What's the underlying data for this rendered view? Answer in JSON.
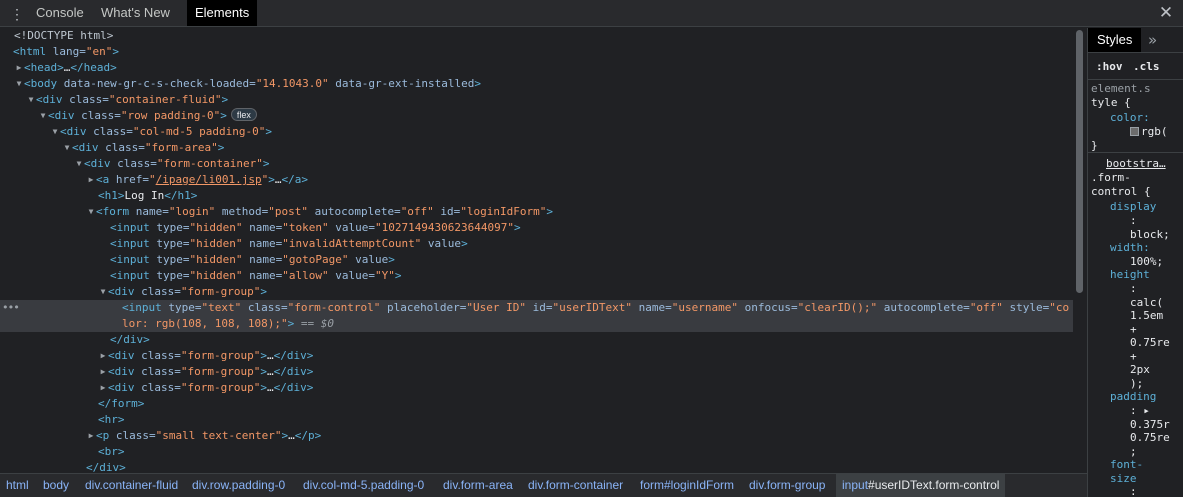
{
  "toolbar": {
    "menu_icon": "vertical-dots-icon",
    "tabs": [
      {
        "label": "Console"
      },
      {
        "label": "What's New"
      },
      {
        "label": "Elements"
      }
    ],
    "close_icon": "close-icon",
    "close_glyph": "✕"
  },
  "dom": {
    "doctype": "<!DOCTYPE html>",
    "html_open": {
      "tag": "<html",
      "attr": " lang=",
      "val": "\"en\"",
      "end": ">"
    },
    "head": {
      "open": "<head>",
      "ellipsis": "…",
      "close": "</head>"
    },
    "body_open": {
      "tag": "<body",
      "attr1": " data-new-gr-c-s-check-loaded=",
      "val1": "\"14.1043.0\"",
      "attr2": " data-gr-ext-installed",
      "end": ">"
    },
    "container": {
      "tag": "<div",
      "attr": " class=",
      "val": "\"container-fluid\"",
      "end": ">"
    },
    "row": {
      "tag": "<div",
      "attr": " class=",
      "val": "\"row padding-0\"",
      "end": ">",
      "badge": "flex"
    },
    "col": {
      "tag": "<div",
      "attr": " class=",
      "val": "\"col-md-5 padding-0\"",
      "end": ">"
    },
    "form_area": {
      "tag": "<div",
      "attr": " class=",
      "val": "\"form-area\"",
      "end": ">"
    },
    "form_container": {
      "tag": "<div",
      "attr": " class=",
      "val": "\"form-container\"",
      "end": ">"
    },
    "anchor": {
      "tag": "<a",
      "attr": " href=",
      "q1": "\"",
      "url": "/ipage/li001.jsp",
      "q2": "\"",
      "end": ">",
      "ellipsis": "…",
      "close": "</a>"
    },
    "h1": {
      "open": "<h1>",
      "text": "Log In",
      "close": "</h1>"
    },
    "form": {
      "tag": "<form",
      "a1": " name=",
      "v1": "\"login\"",
      "a2": " method=",
      "v2": "\"post\"",
      "a3": " autocomplete=",
      "v3": "\"off\"",
      "a4": " id=",
      "v4": "\"loginIdForm\"",
      "end": ">"
    },
    "hidden_inputs": [
      {
        "tag": "<input",
        "a1": " type=",
        "v1": "\"hidden\"",
        "a2": " name=",
        "v2": "\"token\"",
        "a3": " value=",
        "v3": "\"1027149430623644097\"",
        "end": ">"
      },
      {
        "tag": "<input",
        "a1": " type=",
        "v1": "\"hidden\"",
        "a2": " name=",
        "v2": "\"invalidAttemptCount\"",
        "a3": " value",
        "v3": "",
        "end": ">"
      },
      {
        "tag": "<input",
        "a1": " type=",
        "v1": "\"hidden\"",
        "a2": " name=",
        "v2": "\"gotoPage\"",
        "a3": " value",
        "v3": "",
        "end": ">"
      },
      {
        "tag": "<input",
        "a1": " type=",
        "v1": "\"hidden\"",
        "a2": " name=",
        "v2": "\"allow\"",
        "a3": " value=",
        "v3": "\"Y\"",
        "end": ">"
      }
    ],
    "form_group_open": {
      "tag": "<div",
      "attr": " class=",
      "val": "\"form-group\"",
      "end": ">"
    },
    "selected_input": {
      "dots": "•••",
      "tag": "<input",
      "a1": " type=",
      "v1": "\"text\"",
      "a2": " class=",
      "v2": "\"form-control\"",
      "a3": " placeholder=",
      "v3": "\"User ID\"",
      "a4": " id=",
      "v4": "\"userIDText\"",
      "a5": " name=",
      "v5": "\"username\"",
      "a6": " onfocus=",
      "v6": "\"clearID();\"",
      "a7": " autocomplete=",
      "v7": "\"off\"",
      "a8": " style=",
      "v8a": "\"co",
      "v8b": "lor: rgb(108, 108, 108);\"",
      "end": ">",
      "eq": " == $0"
    },
    "div_close": "</div>",
    "collapsed_groups": [
      {
        "tag": "<div",
        "attr": " class=",
        "val": "\"form-group\"",
        "end": ">",
        "ellipsis": "…",
        "close": "</div>"
      },
      {
        "tag": "<div",
        "attr": " class=",
        "val": "\"form-group\"",
        "end": ">",
        "ellipsis": "…",
        "close": "</div>"
      },
      {
        "tag": "<div",
        "attr": " class=",
        "val": "\"form-group\"",
        "end": ">",
        "ellipsis": "…",
        "close": "</div>"
      }
    ],
    "form_close": "</form>",
    "hr": "<hr>",
    "p": {
      "tag": "<p",
      "attr": " class=",
      "val": "\"small text-center\"",
      "end": ">",
      "ellipsis": "…",
      "close": "</p>"
    },
    "br": "<br>",
    "last_div_close": "</div>"
  },
  "styles": {
    "tab": "Styles",
    "more_icon": "double-chevron-right-icon",
    "more_glyph": "»",
    "hov": ":hov",
    "cls": ".cls",
    "element_rule": {
      "sel1": "element.s",
      "sel2": "tyle {",
      "prop": "color:",
      "val": "rgb(",
      "close": "}"
    },
    "bootstrap_rule": {
      "source": "bootstra…",
      "sel1": ".form-",
      "sel2": "control {",
      "lines": [
        {
          "cls": "prop",
          "t": "display"
        },
        {
          "cls": "plain",
          "t": ":"
        },
        {
          "cls": "pval",
          "t": "block;"
        },
        {
          "cls": "prop",
          "t": "width:"
        },
        {
          "cls": "pval",
          "t": "100%;"
        },
        {
          "cls": "prop",
          "t": "height"
        },
        {
          "cls": "plain",
          "t": ":"
        },
        {
          "cls": "pval",
          "t": "calc("
        },
        {
          "cls": "pval",
          "t": "1.5em"
        },
        {
          "cls": "pval",
          "t": "+"
        },
        {
          "cls": "pval",
          "t": "0.75re"
        },
        {
          "cls": "pval",
          "t": "+"
        },
        {
          "cls": "pval",
          "t": "2px"
        },
        {
          "cls": "pval",
          "t": ");"
        },
        {
          "cls": "prop",
          "t": "padding"
        },
        {
          "cls": "plain",
          "t": ": ▸"
        },
        {
          "cls": "pval",
          "t": "0.375r"
        },
        {
          "cls": "pval",
          "t": "0.75re"
        },
        {
          "cls": "pval",
          "t": ";"
        },
        {
          "cls": "prop",
          "t": "font-"
        },
        {
          "cls": "prop",
          "t": "size"
        },
        {
          "cls": "plain",
          "t": ":"
        },
        {
          "cls": "pval",
          "t": "1rem;"
        }
      ]
    }
  },
  "breadcrumbs": [
    {
      "tag": "html",
      "rest": ""
    },
    {
      "tag": "body",
      "rest": ""
    },
    {
      "tag": "div",
      "rest": ".container-fluid"
    },
    {
      "tag": "div",
      "rest": ".row.padding-0"
    },
    {
      "tag": "div",
      "rest": ".col-md-5.padding-0"
    },
    {
      "tag": "div",
      "rest": ".form-area"
    },
    {
      "tag": "div",
      "rest": ".form-container"
    },
    {
      "tag": "form",
      "rest": "#loginIdForm"
    },
    {
      "tag": "div",
      "rest": ".form-group"
    },
    {
      "tag": "input",
      "rest": "#userIDText.form-control"
    }
  ],
  "colors": {
    "background": "#202124",
    "tag": "#5db0d7",
    "attribute": "#9bbbdc",
    "value": "#f29766",
    "selection": "#393b40",
    "link": "#8ab4f8"
  }
}
